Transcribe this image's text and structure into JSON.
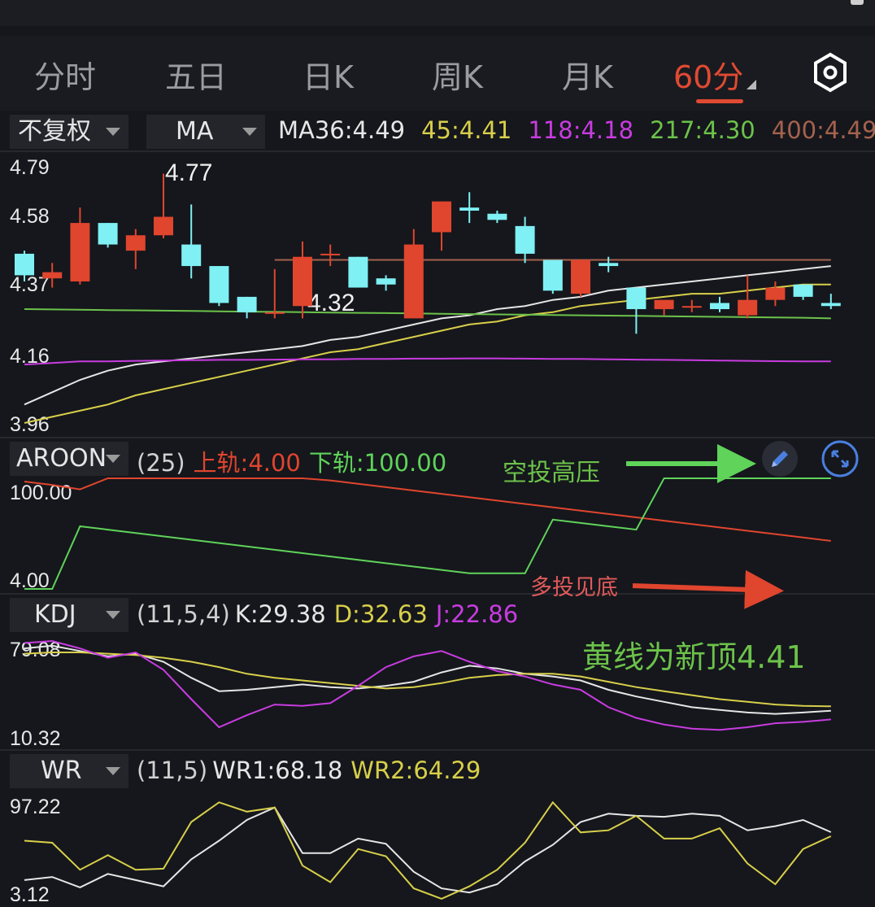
{
  "tabs": [
    "分时",
    "五日",
    "日K",
    "周K",
    "月K",
    "60分"
  ],
  "active_tab": "60分",
  "controls": {
    "adjust": "不复权",
    "indicator": "MA"
  },
  "ma_info": [
    {
      "label": "MA36:",
      "value": "4.49",
      "color": "#e6e6e6"
    },
    {
      "label": "45:",
      "value": "4.41",
      "color": "#d8cf4a"
    },
    {
      "label": "118:",
      "value": "4.18",
      "color": "#c83ce0"
    },
    {
      "label": "217:",
      "value": "4.30",
      "color": "#6cc24a"
    },
    {
      "label": "400:",
      "value": "4.49",
      "color": "#a5624e"
    }
  ],
  "aroon": {
    "name": "AROON",
    "param": "(25)",
    "up_label": "上轨:",
    "up_value": "4.00",
    "down_label": "下轨:",
    "down_value": "100.00"
  },
  "kdj": {
    "name": "KDJ",
    "param": "(11,5,4)",
    "k_label": "K:",
    "k_value": "29.38",
    "d_label": "D:",
    "d_value": "32.63",
    "j_label": "J:",
    "j_value": "22.86"
  },
  "wr": {
    "name": "WR",
    "param": "(11,5)",
    "wr1_label": "WR1:",
    "wr1_value": "68.18",
    "wr2_label": "WR2:",
    "wr2_value": "64.29"
  },
  "annotations": {
    "top": "空投高压",
    "bottom": "多投见底",
    "kdj_note": "黄线为新顶4.41"
  },
  "colors": {
    "up": "#e0452e",
    "down": "#7ff0f4",
    "accent": "#e14a32"
  },
  "chart_data": [
    {
      "type": "candlestick",
      "y_ticks": [
        "4.79",
        "4.58",
        "4.37",
        "4.16",
        "3.96"
      ],
      "ylim": [
        3.96,
        4.79
      ],
      "high_label": "4.77",
      "low_label": "4.32",
      "candles": [
        {
          "o": 4.51,
          "h": 4.52,
          "l": 4.42,
          "c": 4.44
        },
        {
          "o": 4.43,
          "h": 4.48,
          "l": 4.4,
          "c": 4.45
        },
        {
          "o": 4.42,
          "h": 4.66,
          "l": 4.41,
          "c": 4.61
        },
        {
          "o": 4.61,
          "h": 4.61,
          "l": 4.53,
          "c": 4.54
        },
        {
          "o": 4.52,
          "h": 4.59,
          "l": 4.46,
          "c": 4.57
        },
        {
          "o": 4.57,
          "h": 4.77,
          "l": 4.56,
          "c": 4.63
        },
        {
          "o": 4.54,
          "h": 4.67,
          "l": 4.43,
          "c": 4.47
        },
        {
          "o": 4.47,
          "h": 4.47,
          "l": 4.34,
          "c": 4.35
        },
        {
          "o": 4.37,
          "h": 4.37,
          "l": 4.3,
          "c": 4.32
        },
        {
          "o": 4.32,
          "h": 4.46,
          "l": 4.3,
          "c": 4.32
        },
        {
          "o": 4.34,
          "h": 4.55,
          "l": 4.3,
          "c": 4.5
        },
        {
          "o": 4.51,
          "h": 4.54,
          "l": 4.47,
          "c": 4.51
        },
        {
          "o": 4.5,
          "h": 4.5,
          "l": 4.4,
          "c": 4.4
        },
        {
          "o": 4.43,
          "h": 4.44,
          "l": 4.39,
          "c": 4.41
        },
        {
          "o": 4.3,
          "h": 4.59,
          "l": 4.3,
          "c": 4.54
        },
        {
          "o": 4.58,
          "h": 4.68,
          "l": 4.52,
          "c": 4.68
        },
        {
          "o": 4.66,
          "h": 4.71,
          "l": 4.61,
          "c": 4.65
        },
        {
          "o": 4.64,
          "h": 4.65,
          "l": 4.61,
          "c": 4.62
        },
        {
          "o": 4.6,
          "h": 4.63,
          "l": 4.48,
          "c": 4.51
        },
        {
          "o": 4.49,
          "h": 4.49,
          "l": 4.38,
          "c": 4.39
        },
        {
          "o": 4.38,
          "h": 4.49,
          "l": 4.37,
          "c": 4.49
        },
        {
          "o": 4.48,
          "h": 4.5,
          "l": 4.45,
          "c": 4.47
        },
        {
          "o": 4.4,
          "h": 4.4,
          "l": 4.25,
          "c": 4.33
        },
        {
          "o": 4.33,
          "h": 4.35,
          "l": 4.31,
          "c": 4.36
        },
        {
          "o": 4.34,
          "h": 4.36,
          "l": 4.32,
          "c": 4.34
        },
        {
          "o": 4.35,
          "h": 4.37,
          "l": 4.32,
          "c": 4.33
        },
        {
          "o": 4.31,
          "h": 4.44,
          "l": 4.3,
          "c": 4.36
        },
        {
          "o": 4.36,
          "h": 4.42,
          "l": 4.34,
          "c": 4.4
        },
        {
          "o": 4.41,
          "h": 4.41,
          "l": 4.36,
          "c": 4.37
        },
        {
          "o": 4.35,
          "h": 4.38,
          "l": 4.33,
          "c": 4.34
        }
      ],
      "ma_lines": [
        {
          "name": "MA36",
          "color": "#e6e6e6",
          "values": [
            4.02,
            4.06,
            4.1,
            4.13,
            4.15,
            4.16,
            4.17,
            4.18,
            4.19,
            4.2,
            4.21,
            4.23,
            4.24,
            4.26,
            4.28,
            4.3,
            4.31,
            4.33,
            4.34,
            4.36,
            4.37,
            4.39,
            4.4,
            4.41,
            4.42,
            4.43,
            4.44,
            4.45,
            4.46,
            4.47
          ]
        },
        {
          "name": "45",
          "color": "#d8cf4a",
          "values": [
            3.96,
            3.98,
            4.0,
            4.02,
            4.05,
            4.07,
            4.09,
            4.11,
            4.13,
            4.15,
            4.17,
            4.19,
            4.2,
            4.22,
            4.24,
            4.26,
            4.28,
            4.29,
            4.31,
            4.32,
            4.34,
            4.35,
            4.36,
            4.37,
            4.38,
            4.38,
            4.39,
            4.4,
            4.41,
            4.41
          ]
        },
        {
          "name": "118",
          "color": "#c83ce0",
          "values": [
            4.15,
            4.155,
            4.16,
            4.16,
            4.162,
            4.163,
            4.164,
            4.165,
            4.165,
            4.166,
            4.167,
            4.167,
            4.168,
            4.168,
            4.169,
            4.169,
            4.17,
            4.17,
            4.169,
            4.168,
            4.168,
            4.167,
            4.166,
            4.165,
            4.164,
            4.163,
            4.162,
            4.161,
            4.16,
            4.16
          ]
        },
        {
          "name": "217",
          "color": "#6cc24a",
          "values": [
            4.33,
            4.329,
            4.328,
            4.327,
            4.326,
            4.325,
            4.324,
            4.323,
            4.322,
            4.321,
            4.32,
            4.319,
            4.318,
            4.317,
            4.316,
            4.315,
            4.314,
            4.313,
            4.312,
            4.311,
            4.31,
            4.309,
            4.308,
            4.307,
            4.306,
            4.305,
            4.304,
            4.303,
            4.302,
            4.3
          ]
        },
        {
          "name": "400",
          "color": "#a5624e",
          "start": 9,
          "values": [
            4.49,
            4.49,
            4.49,
            4.49,
            4.49,
            4.49,
            4.49,
            4.49,
            4.49,
            4.49,
            4.49,
            4.49,
            4.49,
            4.49,
            4.49,
            4.49,
            4.49,
            4.49,
            4.49,
            4.49,
            4.49
          ]
        }
      ]
    },
    {
      "type": "line",
      "name": "AROON",
      "y_ticks": [
        "100.00",
        "4.00"
      ],
      "ylim": [
        4,
        100
      ],
      "series": [
        {
          "name": "上轨",
          "color": "#e0452e",
          "values": [
            100,
            97,
            93,
            124,
            121,
            118,
            116,
            113,
            110,
            107,
            104,
            101,
            98,
            95,
            92,
            89,
            86,
            83,
            80,
            77,
            74,
            71,
            68,
            65,
            62,
            59,
            56,
            53,
            50,
            47
          ]
        },
        {
          "name": "下轨",
          "color": "#5fd35a",
          "values": [
            4,
            4,
            60,
            57,
            54,
            51,
            48,
            45,
            42,
            39,
            36,
            33,
            30,
            27,
            24,
            21,
            18,
            18,
            18,
            66,
            63,
            60,
            57,
            120,
            120,
            117,
            114,
            111,
            108,
            130
          ]
        }
      ]
    },
    {
      "type": "line",
      "name": "KDJ",
      "y_ticks": [
        "79.08",
        "10.32"
      ],
      "ylim": [
        10.32,
        79.08
      ],
      "series": [
        {
          "name": "K",
          "color": "#e6e6e6",
          "values": [
            76,
            78,
            74,
            70,
            72,
            66,
            54,
            44,
            45,
            47,
            49,
            47,
            46,
            48,
            51,
            58,
            63,
            61,
            57,
            55,
            52,
            45,
            40,
            36,
            32,
            30,
            28,
            27,
            28,
            29.38
          ]
        },
        {
          "name": "D",
          "color": "#d8cf4a",
          "values": [
            72,
            73,
            73,
            72,
            71,
            69,
            66,
            62,
            57,
            54,
            52,
            50,
            48,
            46,
            47,
            50,
            54,
            56,
            57,
            57,
            55,
            51,
            47,
            44,
            41,
            38,
            36,
            34,
            33,
            32.63
          ]
        },
        {
          "name": "J",
          "color": "#c83ce0",
          "values": [
            80,
            82,
            76,
            69,
            73,
            60,
            38,
            17,
            26,
            34,
            33,
            35,
            48,
            62,
            70,
            74,
            66,
            59,
            55,
            49,
            45,
            32,
            24,
            19,
            16,
            15,
            17,
            20,
            21,
            22.86
          ]
        }
      ]
    },
    {
      "type": "line",
      "name": "WR",
      "y_ticks": [
        "97.22",
        "3.12"
      ],
      "ylim": [
        3.12,
        97.22
      ],
      "series": [
        {
          "name": "WR1",
          "color": "#e6e6e6",
          "values": [
            22,
            25,
            15,
            28,
            22,
            16,
            42,
            60,
            80,
            92,
            48,
            48,
            62,
            57,
            30,
            14,
            10,
            18,
            40,
            56,
            78,
            86,
            84,
            83,
            86,
            84,
            70,
            74,
            80,
            68.18
          ]
        },
        {
          "name": "WR2",
          "color": "#d8cf4a",
          "values": [
            60,
            58,
            32,
            46,
            32,
            33,
            78,
            97,
            88,
            92,
            36,
            20,
            52,
            45,
            14,
            4,
            16,
            32,
            58,
            97,
            68,
            70,
            84,
            62,
            62,
            72,
            38,
            18,
            52,
            64.29
          ]
        }
      ]
    }
  ]
}
